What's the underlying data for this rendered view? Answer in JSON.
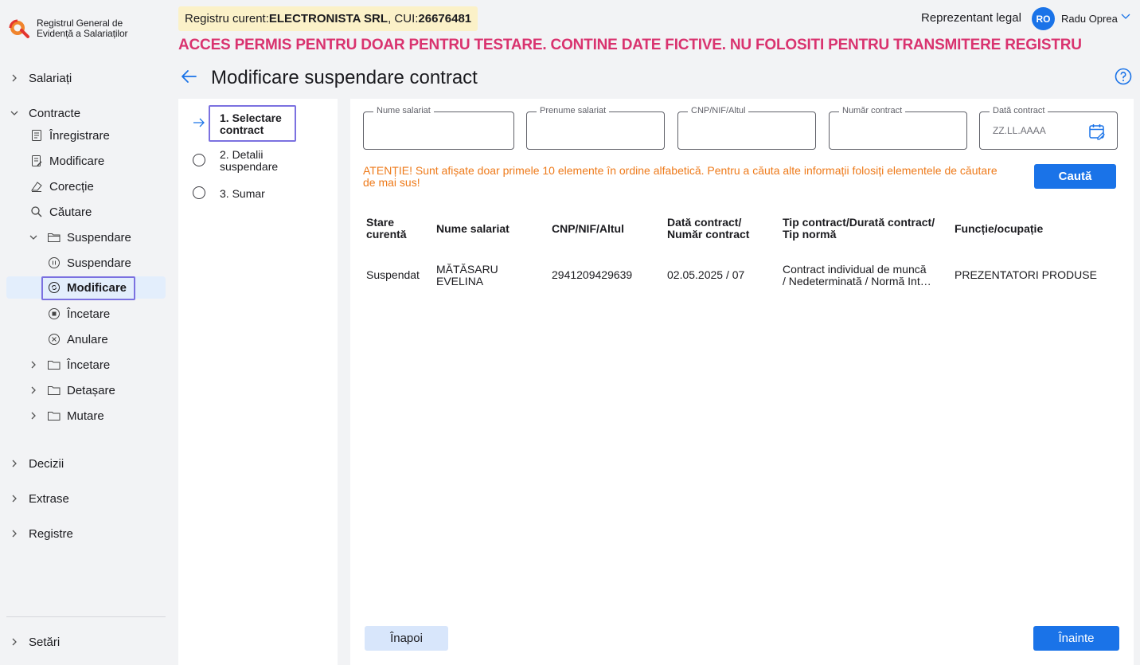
{
  "app": {
    "brand_line1": "Registrul General de",
    "brand_line2": "Evidență a Salariaților"
  },
  "colors": {
    "accent": "#1a73e8",
    "banner": "#d9336f",
    "attention": "#ee7a1a",
    "highlight_box": "#7b71e0",
    "registry_bg": "#fbf1c8"
  },
  "header": {
    "registry_prefix": "Registru curent: ",
    "company": "ELECTRONISTA SRL",
    "cui_prefix": ", CUI: ",
    "cui": "26676481",
    "banner": "ACCES PERMIS PENTRU DOAR PENTRU TESTARE. CONTINE DATE FICTIVE. NU FOLOSITI PENTRU TRANSMITERE REGISTRU",
    "role": "Reprezentant legal",
    "avatar_initials": "RO",
    "user_name": "Radu Oprea"
  },
  "sidebar": {
    "salariati": "Salariați",
    "contracte": "Contracte",
    "inregistrare": "Înregistrare",
    "modificare": "Modificare",
    "corectie": "Corecție",
    "cautare": "Căutare",
    "suspendare_group": "Suspendare",
    "suspendare": "Suspendare",
    "modificare_active": "Modificare",
    "incetare_item": "Încetare",
    "anulare": "Anulare",
    "incetare_group": "Încetare",
    "detasare": "Detașare",
    "mutare": "Mutare",
    "decizii": "Decizii",
    "extrase": "Extrase",
    "registre": "Registre",
    "setari": "Setări"
  },
  "page": {
    "title": "Modificare suspendare contract"
  },
  "steps": {
    "step1_line1": "1. Selectare",
    "step1_line2": "contract",
    "step2_line1": "2. Detalii",
    "step2_line2": "suspendare",
    "step3": "3. Sumar"
  },
  "search": {
    "nume_label": "Nume salariat",
    "prenume_label": "Prenume salariat",
    "cnp_label": "CNP/NIF/Altul",
    "numar_label": "Număr contract",
    "data_label": "Dată contract",
    "data_placeholder": "ZZ.LL.AAAA",
    "attention": "ATENȚIE! Sunt afișate doar primele 10 elemente în ordine alfabetică. Pentru a căuta alte informații folosiți elementele de căutare de mai sus!",
    "search_button": "Caută"
  },
  "table": {
    "h_stare_1": "Stare",
    "h_stare_2": "curentă",
    "h_nume": "Nume salariat",
    "h_cnp": "CNP/NIF/Altul",
    "h_data_1": "Dată contract/",
    "h_data_2": "Număr contract",
    "h_tip_1": "Tip contract/Durată contract/",
    "h_tip_2": "Tip normă",
    "h_functie": "Funcție/ocupație",
    "rows": [
      {
        "stare": "Suspendat",
        "nume_1": "MĂTĂSARU",
        "nume_2": "EVELINA",
        "cnp": "2941209429639",
        "data": "02.05.2025 / 07",
        "tip_1": "Contract individual de muncă",
        "tip_2": "/ Nedeterminată / Normă Int…",
        "functie": "PREZENTATORI PRODUSE"
      }
    ]
  },
  "footer": {
    "back": "Înapoi",
    "next": "Înainte"
  }
}
